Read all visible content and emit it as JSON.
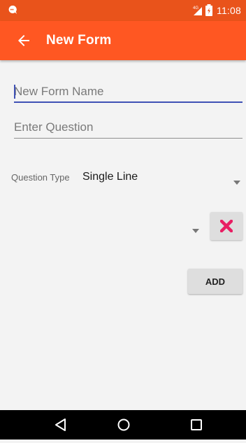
{
  "status_bar": {
    "time": "11:08",
    "network": "4G",
    "icons": [
      "notification-icon",
      "signal-icon",
      "battery-icon"
    ]
  },
  "app_bar": {
    "title": "New Form",
    "back_icon": "arrow-back-icon"
  },
  "form": {
    "name_placeholder": "New Form Name",
    "name_value": "",
    "question_placeholder": "Enter Question",
    "question_value": "",
    "question_type_label": "Question Type",
    "question_type_value": "Single Line",
    "remove_icon": "close-icon",
    "add_label": "ADD"
  },
  "nav_bar": {
    "icons": [
      "back-triangle-icon",
      "home-circle-icon",
      "recents-square-icon"
    ]
  },
  "colors": {
    "status_bar": "#e9531b",
    "app_bar": "#ff5722",
    "accent": "#3f51b5",
    "remove": "#e91e63",
    "background": "#f3f3f3"
  }
}
